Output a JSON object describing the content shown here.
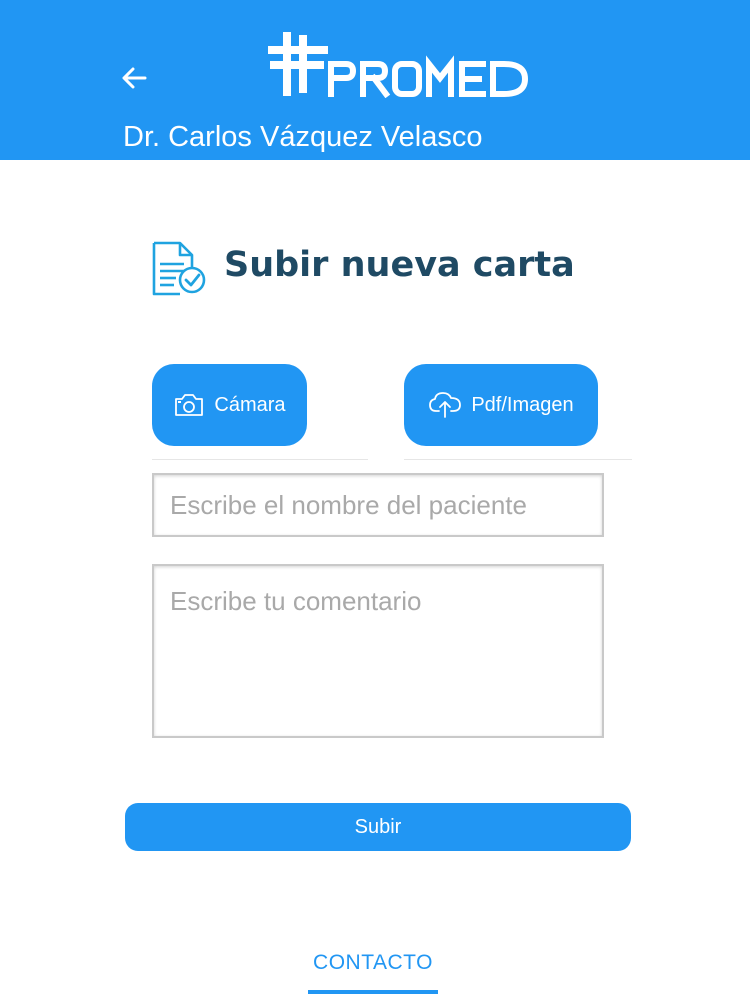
{
  "header": {
    "brand": "PROMED",
    "doctor_name": "Dr. Carlos Vázquez Velasco",
    "back_icon": "arrow-left-icon",
    "background_color": "#2196f3"
  },
  "main": {
    "title": "Subir nueva carta",
    "title_icon": "document-check-icon",
    "title_color": "#1f4a64",
    "upload_buttons": [
      {
        "label": "Cámara",
        "icon": "camera-icon"
      },
      {
        "label": "Pdf/Imagen",
        "icon": "cloud-upload-icon"
      }
    ],
    "patient_name": {
      "value": "",
      "placeholder": "Escribe el nombre del paciente"
    },
    "comment": {
      "value": "",
      "placeholder": "Escribe tu comentario"
    },
    "submit_label": "Subir"
  },
  "footer": {
    "contact_label": "CONTACTO",
    "accent_color": "#2196f3"
  }
}
